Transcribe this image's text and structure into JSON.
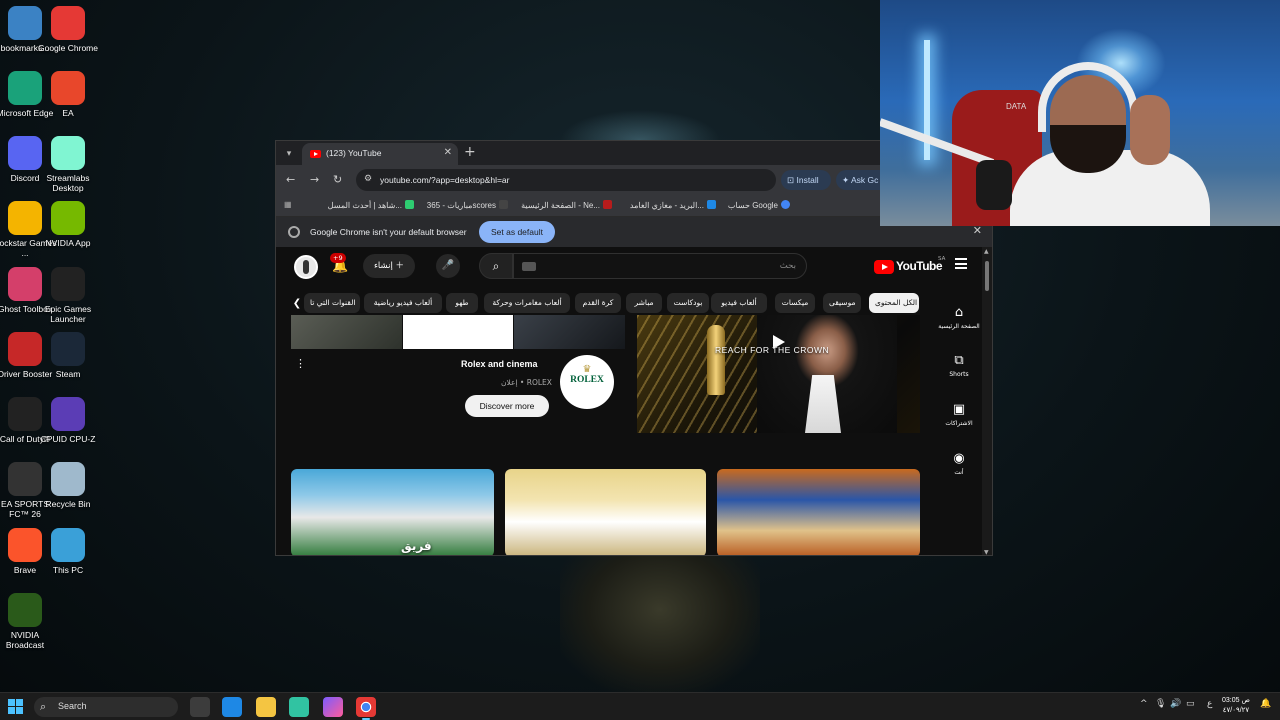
{
  "desktop": {
    "icons": [
      {
        "label": "bookmarks...",
        "icon": "bookmarks-file-icon",
        "color": "#3b82c4"
      },
      {
        "label": "Google Chrome",
        "icon": "chrome-icon",
        "color": "#e53935"
      },
      {
        "label": "Microsoft Edge",
        "icon": "edge-icon",
        "color": "#1aa27a"
      },
      {
        "label": "EA",
        "icon": "ea-icon",
        "color": "#e8472b"
      },
      {
        "label": "Discord",
        "icon": "discord-icon",
        "color": "#5865f2"
      },
      {
        "label": "Streamlabs Desktop",
        "icon": "streamlabs-icon",
        "color": "#80f5d2"
      },
      {
        "label": "Rockstar Games ...",
        "icon": "rockstar-icon",
        "color": "#f4b400"
      },
      {
        "label": "NVIDIA App",
        "icon": "nvidia-icon",
        "color": "#76b900"
      },
      {
        "label": "Ghost Toolbox",
        "icon": "ghost-toolbox-icon",
        "color": "#d43f6a"
      },
      {
        "label": "Epic Games Launcher",
        "icon": "epic-games-icon",
        "color": "#222222"
      },
      {
        "label": "Driver Booster",
        "icon": "driver-booster-icon",
        "color": "#c62828"
      },
      {
        "label": "Steam",
        "icon": "steam-icon",
        "color": "#1b2838"
      },
      {
        "label": "Call of Duty®",
        "icon": "call-of-duty-icon",
        "color": "#222222"
      },
      {
        "label": "CPUID CPU-Z",
        "icon": "cpuz-icon",
        "color": "#5b3db5"
      },
      {
        "label": "EA SPORTS FC™ 26",
        "icon": "ea-sports-fc-icon",
        "color": "#333333"
      },
      {
        "label": "Recycle Bin",
        "icon": "recycle-bin-icon",
        "color": "#9fb9cc"
      },
      {
        "label": "Brave",
        "icon": "brave-icon",
        "color": "#fb542b"
      },
      {
        "label": "This PC",
        "icon": "this-pc-icon",
        "color": "#3aa0d8"
      },
      {
        "label": "NVIDIA Broadcast",
        "icon": "nvidia-broadcast-icon",
        "color": "#2a5a1a"
      }
    ]
  },
  "browser": {
    "tab_title": "(123) YouTube",
    "url": "youtube.com/?app=desktop&hl=ar",
    "install_label": "Install",
    "ask_label": "Ask Gc",
    "bookmarks": [
      {
        "label": "حساب Google",
        "color": "#4285f4"
      },
      {
        "label": "البريد - مغازي الغامد...",
        "color": "#1e88e5"
      },
      {
        "label": "الصفحة الرئيسية - Ne...",
        "color": "#b71c1c"
      },
      {
        "label": "مباريات - 365scores",
        "color": "#444444"
      },
      {
        "label": "شاهد | أحدث المسل...",
        "color": "#2ecc71"
      }
    ],
    "infobar": {
      "message": "Google Chrome isn't your default browser",
      "button": "Set as default"
    }
  },
  "youtube": {
    "logo": "YouTube",
    "region": "SA",
    "search_placeholder": "بحث",
    "create_label": "إنشاء",
    "notifications_badge": "+9",
    "chips": [
      "الكل المحتوى",
      "موسيقى",
      "ميكسات",
      "ألعاب فيديو",
      "بودكاست",
      "مباشر",
      "كرة القدم",
      "ألعاب مغامرات وحركة",
      "طهو",
      "ألعاب فيديو رياضية",
      "القنوات التي تا"
    ],
    "guide": [
      {
        "label": "الصفحة الرئيسية",
        "icon": "home-icon"
      },
      {
        "label": "Shorts",
        "icon": "shorts-icon"
      },
      {
        "label": "الاشتراكات",
        "icon": "subscriptions-icon"
      },
      {
        "label": "أنت",
        "icon": "you-icon"
      }
    ],
    "ad": {
      "title": "Rolex and cinema",
      "sponsor": "إعلان • ROLEX",
      "cta": "Discover more",
      "logo_text": "ROLEX",
      "video_caption": "REACH FOR THE CROWN"
    },
    "video_tag": "فريق"
  },
  "webcam": {
    "wall_text": "DATA"
  },
  "taskbar": {
    "search_label": "Search",
    "apps": [
      "file-explorer-icon",
      "store-icon",
      "folder-icon",
      "streamlabs-icon",
      "messenger-icon",
      "chrome-icon"
    ],
    "time": "03:05 ص",
    "date": "٤٧/٠٩/٢٧",
    "lang": "ع"
  }
}
